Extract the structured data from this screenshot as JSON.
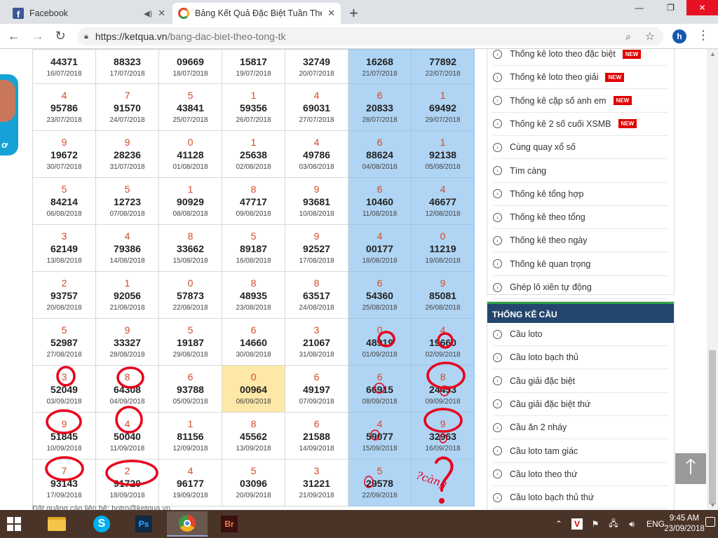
{
  "browser": {
    "tabs": [
      {
        "title": "Facebook",
        "favicon": "facebook-icon"
      },
      {
        "title": "Bảng Kết Quả Đặc Biệt Tuần Theo Tổng",
        "favicon": "ketqua-icon"
      }
    ],
    "url_host": "https://ketqua.vn",
    "url_path": "/bang-dac-biet-theo-tong-tk",
    "profile_initial": "h"
  },
  "table": {
    "rows": [
      [
        {
          "total": "",
          "number": "44371",
          "date": "16/07/2018"
        },
        {
          "total": "",
          "number": "88323",
          "date": "17/07/2018"
        },
        {
          "total": "",
          "number": "09669",
          "date": "18/07/2018"
        },
        {
          "total": "",
          "number": "15817",
          "date": "19/07/2018"
        },
        {
          "total": "",
          "number": "32749",
          "date": "20/07/2018"
        },
        {
          "total": "",
          "number": "16268",
          "date": "21/07/2018"
        },
        {
          "total": "",
          "number": "77892",
          "date": "22/07/2018"
        }
      ],
      [
        {
          "total": "4",
          "number": "95786",
          "date": "23/07/2018"
        },
        {
          "total": "7",
          "number": "91570",
          "date": "24/07/2018"
        },
        {
          "total": "5",
          "number": "43841",
          "date": "25/07/2018"
        },
        {
          "total": "1",
          "number": "59356",
          "date": "26/07/2018"
        },
        {
          "total": "4",
          "number": "69031",
          "date": "27/07/2018"
        },
        {
          "total": "6",
          "number": "20833",
          "date": "28/07/2018"
        },
        {
          "total": "1",
          "number": "69492",
          "date": "29/07/2018"
        }
      ],
      [
        {
          "total": "9",
          "number": "19672",
          "date": "30/07/2018"
        },
        {
          "total": "9",
          "number": "28236",
          "date": "31/07/2018"
        },
        {
          "total": "0",
          "number": "41128",
          "date": "01/08/2018"
        },
        {
          "total": "1",
          "number": "25638",
          "date": "02/08/2018"
        },
        {
          "total": "4",
          "number": "49786",
          "date": "03/08/2018"
        },
        {
          "total": "6",
          "number": "88624",
          "date": "04/08/2018"
        },
        {
          "total": "1",
          "number": "92138",
          "date": "05/08/2018"
        }
      ],
      [
        {
          "total": "5",
          "number": "84214",
          "date": "06/08/2018"
        },
        {
          "total": "5",
          "number": "12723",
          "date": "07/08/2018"
        },
        {
          "total": "1",
          "number": "90929",
          "date": "08/08/2018"
        },
        {
          "total": "8",
          "number": "47717",
          "date": "09/08/2018"
        },
        {
          "total": "9",
          "number": "93681",
          "date": "10/08/2018"
        },
        {
          "total": "6",
          "number": "10460",
          "date": "11/08/2018"
        },
        {
          "total": "4",
          "number": "46677",
          "date": "12/08/2018"
        }
      ],
      [
        {
          "total": "3",
          "number": "62149",
          "date": "13/08/2018"
        },
        {
          "total": "4",
          "number": "79386",
          "date": "14/08/2018"
        },
        {
          "total": "8",
          "number": "33662",
          "date": "15/08/2018"
        },
        {
          "total": "5",
          "number": "89187",
          "date": "16/08/2018"
        },
        {
          "total": "9",
          "number": "92527",
          "date": "17/08/2018"
        },
        {
          "total": "4",
          "number": "00177",
          "date": "18/08/2018"
        },
        {
          "total": "0",
          "number": "11219",
          "date": "19/08/2018"
        }
      ],
      [
        {
          "total": "2",
          "number": "93757",
          "date": "20/08/2018"
        },
        {
          "total": "1",
          "number": "92056",
          "date": "21/08/2018"
        },
        {
          "total": "0",
          "number": "57873",
          "date": "22/08/2018"
        },
        {
          "total": "8",
          "number": "48935",
          "date": "23/08/2018"
        },
        {
          "total": "8",
          "number": "63517",
          "date": "24/08/2018"
        },
        {
          "total": "6",
          "number": "54360",
          "date": "25/08/2018"
        },
        {
          "total": "9",
          "number": "85081",
          "date": "26/08/2018"
        }
      ],
      [
        {
          "total": "5",
          "number": "52987",
          "date": "27/08/2018"
        },
        {
          "total": "9",
          "number": "33327",
          "date": "28/08/2018"
        },
        {
          "total": "5",
          "number": "19187",
          "date": "29/08/2018"
        },
        {
          "total": "6",
          "number": "14660",
          "date": "30/08/2018"
        },
        {
          "total": "3",
          "number": "21067",
          "date": "31/08/2018"
        },
        {
          "total": "0",
          "number": "48919",
          "date": "01/09/2018"
        },
        {
          "total": "4",
          "number": "19660",
          "date": "02/09/2018"
        }
      ],
      [
        {
          "total": "3",
          "number": "52049",
          "date": "03/09/2018"
        },
        {
          "total": "8",
          "number": "64308",
          "date": "04/09/2018"
        },
        {
          "total": "6",
          "number": "93788",
          "date": "05/09/2018"
        },
        {
          "total": "0",
          "number": "00964",
          "date": "06/09/2018"
        },
        {
          "total": "6",
          "number": "49197",
          "date": "07/09/2018"
        },
        {
          "total": "6",
          "number": "66915",
          "date": "08/09/2018"
        },
        {
          "total": "8",
          "number": "24453",
          "date": "09/09/2018"
        }
      ],
      [
        {
          "total": "9",
          "number": "51845",
          "date": "10/09/2018"
        },
        {
          "total": "4",
          "number": "50040",
          "date": "11/09/2018"
        },
        {
          "total": "1",
          "number": "81156",
          "date": "12/09/2018"
        },
        {
          "total": "8",
          "number": "45562",
          "date": "13/09/2018"
        },
        {
          "total": "6",
          "number": "21588",
          "date": "14/09/2018"
        },
        {
          "total": "4",
          "number": "59077",
          "date": "15/09/2018"
        },
        {
          "total": "9",
          "number": "32963",
          "date": "16/09/2018"
        }
      ],
      [
        {
          "total": "7",
          "number": "93143",
          "date": "17/09/2018"
        },
        {
          "total": "2",
          "number": "91720",
          "date": "18/09/2018"
        },
        {
          "total": "4",
          "number": "96177",
          "date": "19/09/2018"
        },
        {
          "total": "5",
          "number": "03096",
          "date": "20/09/2018"
        },
        {
          "total": "3",
          "number": "31221",
          "date": "21/09/2018"
        },
        {
          "total": "5",
          "number": "29578",
          "date": "22/09/2018"
        },
        {
          "total": "",
          "number": "",
          "date": ""
        }
      ]
    ],
    "highlighted_cell": "06/09/2018"
  },
  "footer_text": "Đặt quảng cáo liên hệ: hotro@ketqua.vn",
  "sidebar": {
    "stat_items": [
      {
        "label": "Thống kê loto theo đặc biệt",
        "badge": "NEW"
      },
      {
        "label": "Thống kê loto theo giải",
        "badge": "NEW"
      },
      {
        "label": "Thống kê cặp số anh em",
        "badge": "NEW"
      },
      {
        "label": "Thống kê 2 số cuối XSMB",
        "badge": "NEW"
      },
      {
        "label": "Cùng quay xổ số",
        "badge": ""
      },
      {
        "label": "Tìm càng",
        "badge": ""
      },
      {
        "label": "Thống kê tổng hợp",
        "badge": ""
      },
      {
        "label": "Thống kê theo tổng",
        "badge": ""
      },
      {
        "label": "Thống kê theo ngày",
        "badge": ""
      },
      {
        "label": "Thống kê quan trọng",
        "badge": ""
      },
      {
        "label": "Ghép lô xiên tự động",
        "badge": ""
      }
    ],
    "cau_header": "THỐNG KÊ CẦU",
    "cau_items": [
      "Cầu loto",
      "Cầu loto bạch thủ",
      "Cầu giải đặc biệt",
      "Cầu giải đặc biệt thứ",
      "Cầu ăn 2 nháy",
      "Cầu loto tam giác",
      "Cầu loto theo thứ",
      "Cầu loto bạch thủ thứ"
    ]
  },
  "annotation_text": "?càng",
  "side_ad_text": "ơ",
  "taskbar": {
    "language": "ENG",
    "time": "9:45 AM",
    "date": "23/09/2018",
    "apps": [
      "file-explorer-icon",
      "skype-icon",
      "photoshop-icon",
      "chrome-icon",
      "bridge-icon"
    ]
  },
  "colors": {
    "total_red": "#d24a29",
    "weekend_blue": "#b0d4f3",
    "highlight_yellow": "#fde8a8",
    "sidebar_header": "#23466e",
    "new_badge": "#e00000",
    "annotation_red": "#e8001c"
  }
}
